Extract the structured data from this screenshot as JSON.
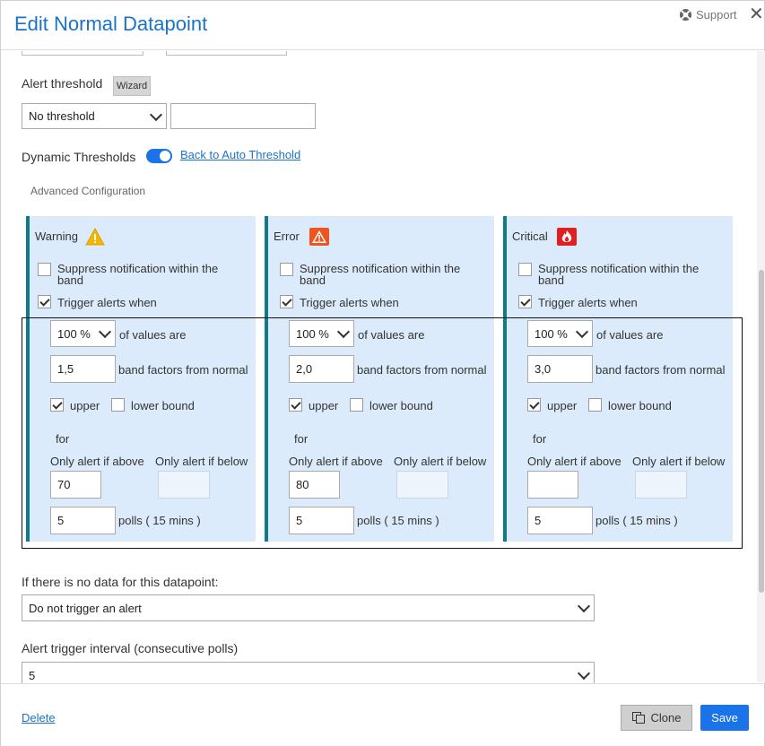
{
  "dialog": {
    "title": "Edit Normal Datapoint",
    "support_label": "Support",
    "close_glyph": "✕"
  },
  "alert_threshold": {
    "label": "Alert threshold",
    "wizard_label": "Wizard",
    "operator_value": "No threshold",
    "value": ""
  },
  "dynamic": {
    "label": "Dynamic Thresholds",
    "enabled": true,
    "back_link": "Back to Auto Threshold",
    "advanced_label": "Advanced Configuration"
  },
  "severities": [
    {
      "name": "Warning",
      "icon": "warning-triangle-icon",
      "color": "#f5b400",
      "suppress_label": "Suppress notification within the band",
      "suppress_checked": false,
      "trigger_label": "Trigger alerts when",
      "trigger_checked": true,
      "percent": "100 %",
      "of_values_label": "of values are",
      "band_factor": "1,5",
      "band_label": "band factors from normal",
      "upper_checked": true,
      "upper_label": "upper",
      "lower_checked": false,
      "lower_label": "lower bound",
      "for_label": "for",
      "above_label": "Only alert if above",
      "below_label": "Only alert if below",
      "above_value": "70",
      "below_value": "",
      "polls": "5",
      "polls_label": "polls ( 15 mins )"
    },
    {
      "name": "Error",
      "icon": "error-triangle-icon",
      "color": "#f0541e",
      "suppress_label": "Suppress notification within the band",
      "suppress_checked": false,
      "trigger_label": "Trigger alerts when",
      "trigger_checked": true,
      "percent": "100 %",
      "of_values_label": "of values are",
      "band_factor": "2,0",
      "band_label": "band factors from normal",
      "upper_checked": true,
      "upper_label": "upper",
      "lower_checked": false,
      "lower_label": "lower bound",
      "for_label": "for",
      "above_label": "Only alert if above",
      "below_label": "Only alert if below",
      "above_value": "80",
      "below_value": "",
      "polls": "5",
      "polls_label": "polls ( 15 mins )"
    },
    {
      "name": "Critical",
      "icon": "critical-fire-icon",
      "color": "#e02020",
      "suppress_label": "Suppress notification within the band",
      "suppress_checked": false,
      "trigger_label": "Trigger alerts when",
      "trigger_checked": true,
      "percent": "100 %",
      "of_values_label": "of values are",
      "band_factor": "3,0",
      "band_label": "band factors from normal",
      "upper_checked": true,
      "upper_label": "upper",
      "lower_checked": false,
      "lower_label": "lower bound",
      "for_label": "for",
      "above_label": "Only alert if above",
      "below_label": "Only alert if below",
      "above_value": "",
      "below_value": "",
      "polls": "5",
      "polls_label": "polls ( 15 mins )"
    }
  ],
  "no_data": {
    "label": "If there is no data for this datapoint:",
    "value": "Do not trigger an alert"
  },
  "trigger_interval": {
    "label": "Alert trigger interval (consecutive polls)",
    "value": "5"
  },
  "footer": {
    "delete_label": "Delete",
    "clone_label": "Clone",
    "save_label": "Save"
  },
  "colors": {
    "accent": "#1a73e8",
    "panel_bg": "#dcebfb",
    "panel_border": "#0f7a8c"
  }
}
